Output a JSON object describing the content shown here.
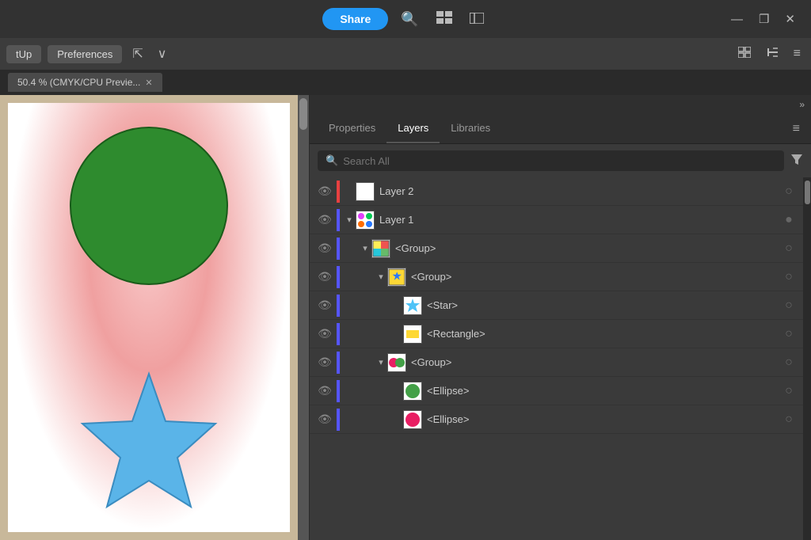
{
  "titleBar": {
    "shareLabel": "Share",
    "searchIcon": "🔍",
    "gridIcon": "⊞",
    "panelIcon": "▭",
    "minimizeIcon": "—",
    "restoreIcon": "❐",
    "closeIcon": "✕"
  },
  "toolbar": {
    "setupLabel": "tUp",
    "prefsLabel": "Preferences",
    "cursorIcon": "⇱",
    "chevronIcon": "∨",
    "gridIcon2": "⊟",
    "alignIcon": "⊨",
    "listIcon": "≡"
  },
  "tabBar": {
    "tabLabel": "50.4 % (CMYK/CPU Previe...",
    "closeIcon": "✕"
  },
  "rightPanel": {
    "extraChevron": "»",
    "tabs": [
      {
        "label": "Properties",
        "active": false
      },
      {
        "label": "Layers",
        "active": true
      },
      {
        "label": "Libraries",
        "active": false
      }
    ],
    "menuIcon": "≡",
    "search": {
      "placeholder": "Search All",
      "filterIcon": "▼"
    },
    "layers": [
      {
        "id": "layer2",
        "name": "Layer 2",
        "indent": 0,
        "colorBar": "#e84040",
        "hasChevron": false,
        "chevronOpen": false,
        "thumbType": "white-square"
      },
      {
        "id": "layer1",
        "name": "Layer 1",
        "indent": 0,
        "colorBar": "#5555ff",
        "hasChevron": true,
        "chevronOpen": true,
        "thumbType": "layer1-thumb"
      },
      {
        "id": "group1",
        "name": "<Group>",
        "indent": 1,
        "colorBar": "#5555ff",
        "hasChevron": true,
        "chevronOpen": true,
        "thumbType": "group-thumb"
      },
      {
        "id": "group2",
        "name": "<Group>",
        "indent": 2,
        "colorBar": "#5555ff",
        "hasChevron": true,
        "chevronOpen": true,
        "thumbType": "group2-thumb"
      },
      {
        "id": "star",
        "name": "<Star>",
        "indent": 3,
        "colorBar": "#5555ff",
        "hasChevron": false,
        "chevronOpen": false,
        "thumbType": "star-thumb"
      },
      {
        "id": "rectangle",
        "name": "<Rectangle>",
        "indent": 3,
        "colorBar": "#5555ff",
        "hasChevron": false,
        "chevronOpen": false,
        "thumbType": "rect-thumb"
      },
      {
        "id": "group3",
        "name": "<Group>",
        "indent": 2,
        "colorBar": "#5555ff",
        "hasChevron": true,
        "chevronOpen": true,
        "thumbType": "group3-thumb"
      },
      {
        "id": "ellipse1",
        "name": "<Ellipse>",
        "indent": 3,
        "colorBar": "#5555ff",
        "hasChevron": false,
        "chevronOpen": false,
        "thumbType": "ellipse1-thumb"
      },
      {
        "id": "ellipse2",
        "name": "<Ellipse>",
        "indent": 3,
        "colorBar": "#5555ff",
        "hasChevron": false,
        "chevronOpen": false,
        "thumbType": "ellipse2-thumb"
      }
    ]
  }
}
